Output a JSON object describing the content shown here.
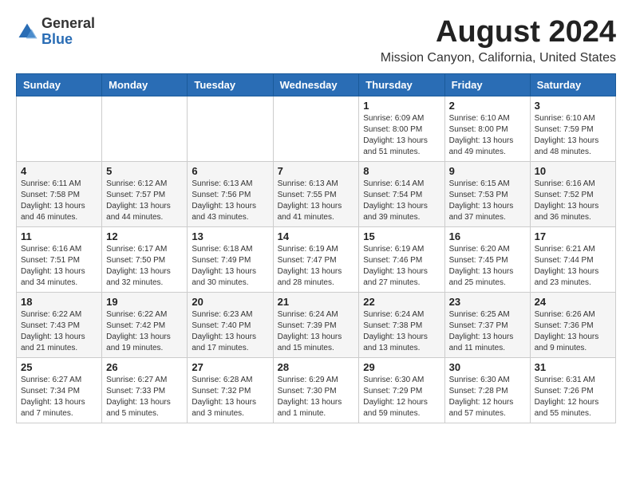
{
  "logo": {
    "general": "General",
    "blue": "Blue"
  },
  "title": "August 2024",
  "location": "Mission Canyon, California, United States",
  "days_of_week": [
    "Sunday",
    "Monday",
    "Tuesday",
    "Wednesday",
    "Thursday",
    "Friday",
    "Saturday"
  ],
  "weeks": [
    [
      {
        "day": "",
        "info": ""
      },
      {
        "day": "",
        "info": ""
      },
      {
        "day": "",
        "info": ""
      },
      {
        "day": "",
        "info": ""
      },
      {
        "day": "1",
        "info": "Sunrise: 6:09 AM\nSunset: 8:00 PM\nDaylight: 13 hours\nand 51 minutes."
      },
      {
        "day": "2",
        "info": "Sunrise: 6:10 AM\nSunset: 8:00 PM\nDaylight: 13 hours\nand 49 minutes."
      },
      {
        "day": "3",
        "info": "Sunrise: 6:10 AM\nSunset: 7:59 PM\nDaylight: 13 hours\nand 48 minutes."
      }
    ],
    [
      {
        "day": "4",
        "info": "Sunrise: 6:11 AM\nSunset: 7:58 PM\nDaylight: 13 hours\nand 46 minutes."
      },
      {
        "day": "5",
        "info": "Sunrise: 6:12 AM\nSunset: 7:57 PM\nDaylight: 13 hours\nand 44 minutes."
      },
      {
        "day": "6",
        "info": "Sunrise: 6:13 AM\nSunset: 7:56 PM\nDaylight: 13 hours\nand 43 minutes."
      },
      {
        "day": "7",
        "info": "Sunrise: 6:13 AM\nSunset: 7:55 PM\nDaylight: 13 hours\nand 41 minutes."
      },
      {
        "day": "8",
        "info": "Sunrise: 6:14 AM\nSunset: 7:54 PM\nDaylight: 13 hours\nand 39 minutes."
      },
      {
        "day": "9",
        "info": "Sunrise: 6:15 AM\nSunset: 7:53 PM\nDaylight: 13 hours\nand 37 minutes."
      },
      {
        "day": "10",
        "info": "Sunrise: 6:16 AM\nSunset: 7:52 PM\nDaylight: 13 hours\nand 36 minutes."
      }
    ],
    [
      {
        "day": "11",
        "info": "Sunrise: 6:16 AM\nSunset: 7:51 PM\nDaylight: 13 hours\nand 34 minutes."
      },
      {
        "day": "12",
        "info": "Sunrise: 6:17 AM\nSunset: 7:50 PM\nDaylight: 13 hours\nand 32 minutes."
      },
      {
        "day": "13",
        "info": "Sunrise: 6:18 AM\nSunset: 7:49 PM\nDaylight: 13 hours\nand 30 minutes."
      },
      {
        "day": "14",
        "info": "Sunrise: 6:19 AM\nSunset: 7:47 PM\nDaylight: 13 hours\nand 28 minutes."
      },
      {
        "day": "15",
        "info": "Sunrise: 6:19 AM\nSunset: 7:46 PM\nDaylight: 13 hours\nand 27 minutes."
      },
      {
        "day": "16",
        "info": "Sunrise: 6:20 AM\nSunset: 7:45 PM\nDaylight: 13 hours\nand 25 minutes."
      },
      {
        "day": "17",
        "info": "Sunrise: 6:21 AM\nSunset: 7:44 PM\nDaylight: 13 hours\nand 23 minutes."
      }
    ],
    [
      {
        "day": "18",
        "info": "Sunrise: 6:22 AM\nSunset: 7:43 PM\nDaylight: 13 hours\nand 21 minutes."
      },
      {
        "day": "19",
        "info": "Sunrise: 6:22 AM\nSunset: 7:42 PM\nDaylight: 13 hours\nand 19 minutes."
      },
      {
        "day": "20",
        "info": "Sunrise: 6:23 AM\nSunset: 7:40 PM\nDaylight: 13 hours\nand 17 minutes."
      },
      {
        "day": "21",
        "info": "Sunrise: 6:24 AM\nSunset: 7:39 PM\nDaylight: 13 hours\nand 15 minutes."
      },
      {
        "day": "22",
        "info": "Sunrise: 6:24 AM\nSunset: 7:38 PM\nDaylight: 13 hours\nand 13 minutes."
      },
      {
        "day": "23",
        "info": "Sunrise: 6:25 AM\nSunset: 7:37 PM\nDaylight: 13 hours\nand 11 minutes."
      },
      {
        "day": "24",
        "info": "Sunrise: 6:26 AM\nSunset: 7:36 PM\nDaylight: 13 hours\nand 9 minutes."
      }
    ],
    [
      {
        "day": "25",
        "info": "Sunrise: 6:27 AM\nSunset: 7:34 PM\nDaylight: 13 hours\nand 7 minutes."
      },
      {
        "day": "26",
        "info": "Sunrise: 6:27 AM\nSunset: 7:33 PM\nDaylight: 13 hours\nand 5 minutes."
      },
      {
        "day": "27",
        "info": "Sunrise: 6:28 AM\nSunset: 7:32 PM\nDaylight: 13 hours\nand 3 minutes."
      },
      {
        "day": "28",
        "info": "Sunrise: 6:29 AM\nSunset: 7:30 PM\nDaylight: 13 hours\nand 1 minute."
      },
      {
        "day": "29",
        "info": "Sunrise: 6:30 AM\nSunset: 7:29 PM\nDaylight: 12 hours\nand 59 minutes."
      },
      {
        "day": "30",
        "info": "Sunrise: 6:30 AM\nSunset: 7:28 PM\nDaylight: 12 hours\nand 57 minutes."
      },
      {
        "day": "31",
        "info": "Sunrise: 6:31 AM\nSunset: 7:26 PM\nDaylight: 12 hours\nand 55 minutes."
      }
    ]
  ]
}
